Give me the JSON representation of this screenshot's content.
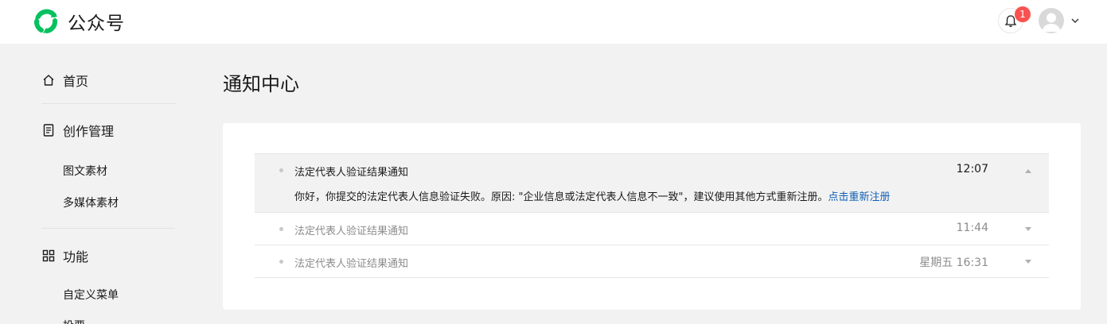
{
  "header": {
    "brand_name": "公众号",
    "notification_count": "1",
    "brand_color": "#07c160"
  },
  "sidebar": {
    "home_label": "首页",
    "creation_label": "创作管理",
    "creation_items": [
      "图文素材",
      "多媒体素材"
    ],
    "features_label": "功能",
    "features_items": [
      "自定义菜单",
      "投票"
    ]
  },
  "main": {
    "title": "通知中心",
    "notifications": [
      {
        "title": "法定代表人验证结果通知",
        "time": "12:07",
        "expanded": true,
        "body": "你好，你提交的法定代表人信息验证失败。原因: \"企业信息或法定代表人信息不一致\"，建议使用其他方式重新注册。",
        "link": "点击重新注册"
      },
      {
        "title": "法定代表人验证结果通知",
        "time": "11:44",
        "expanded": false
      },
      {
        "title": "法定代表人验证结果通知",
        "time": "星期五 16:31",
        "expanded": false
      }
    ]
  },
  "colors": {
    "link": "#0f5fb5",
    "badge": "#fa5151",
    "expanded_row_bg": "#f2f2f2"
  }
}
